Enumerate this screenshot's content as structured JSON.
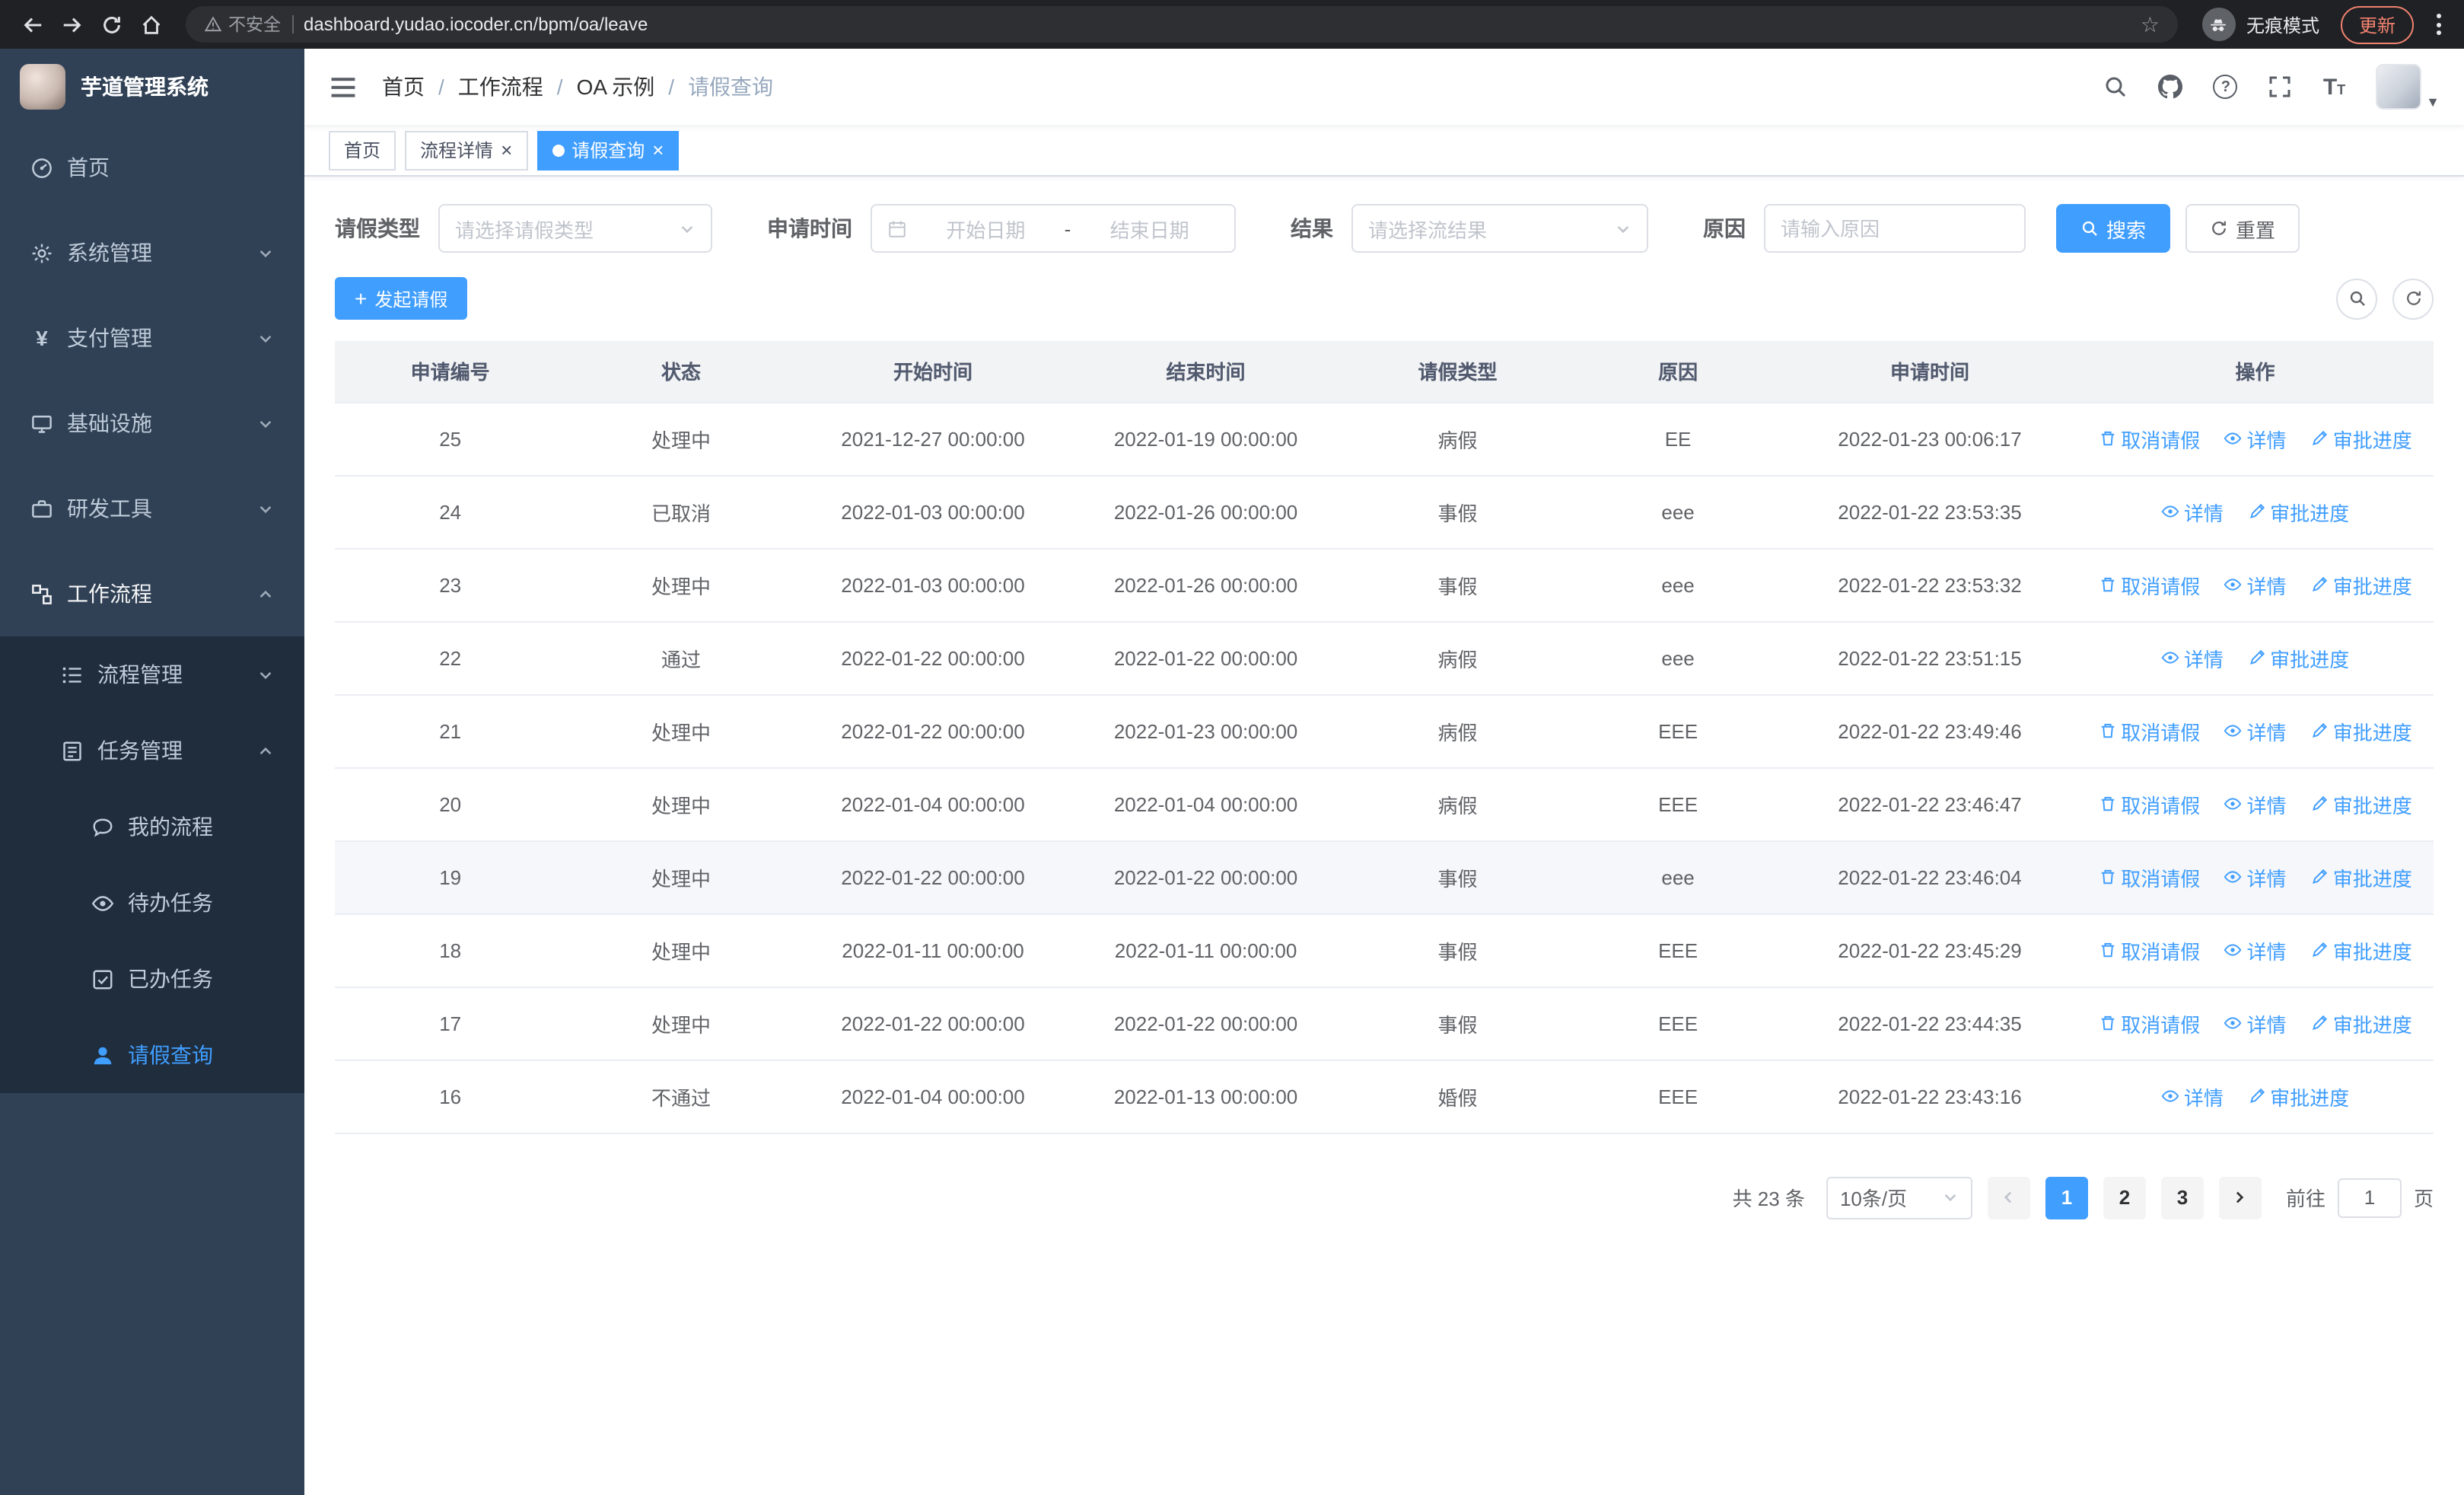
{
  "colors": {
    "primary": "#409eff",
    "sidebar_bg": "#304156",
    "submenu_bg": "#1f2d3d",
    "sidebar_text": "#bfcbd9",
    "chrome_bar_bg": "#202124",
    "update_badge": "#f0826f",
    "table_header_bg": "#f2f3f5"
  },
  "icons": {
    "close": "×",
    "star": "☆",
    "caret_down": "▼",
    "plus": "+",
    "yen": "¥",
    "question": "?",
    "font_t": "T"
  },
  "browser": {
    "security_label": "不安全",
    "url": "dashboard.yudao.iocoder.cn/bpm/oa/leave",
    "incognito_label": "无痕模式",
    "update_button": "更新"
  },
  "sidebar": {
    "logo_title": "芋道管理系统",
    "items": [
      {
        "label": "首页"
      },
      {
        "label": "系统管理"
      },
      {
        "label": "支付管理"
      },
      {
        "label": "基础设施"
      },
      {
        "label": "研发工具"
      },
      {
        "label": "工作流程"
      }
    ],
    "submenu": [
      {
        "label": "流程管理"
      },
      {
        "label": "任务管理"
      }
    ],
    "task_children": [
      {
        "label": "我的流程"
      },
      {
        "label": "待办任务"
      },
      {
        "label": "已办任务"
      },
      {
        "label": "请假查询"
      }
    ]
  },
  "header": {
    "breadcrumb": [
      {
        "label": "首页"
      },
      {
        "label": "工作流程"
      },
      {
        "label": "OA 示例"
      },
      {
        "label": "请假查询"
      }
    ]
  },
  "tabs": [
    {
      "label": "首页"
    },
    {
      "label": "流程详情"
    },
    {
      "label": "请假查询"
    }
  ],
  "filters": {
    "leave_type_label": "请假类型",
    "leave_type_placeholder": "请选择请假类型",
    "apply_time_label": "申请时间",
    "start_date_placeholder": "开始日期",
    "range_separator": "-",
    "end_date_placeholder": "结束日期",
    "result_label": "结果",
    "result_placeholder": "请选择流结果",
    "reason_label": "原因",
    "reason_placeholder": "请输入原因",
    "search_button": "搜索",
    "reset_button": "重置"
  },
  "toolbar": {
    "create_button": "发起请假"
  },
  "table": {
    "columns": [
      "申请编号",
      "状态",
      "开始时间",
      "结束时间",
      "请假类型",
      "原因",
      "申请时间",
      "操作"
    ],
    "actions": {
      "cancel": "取消请假",
      "detail": "详情",
      "progress": "审批进度"
    },
    "rows": [
      {
        "id": "25",
        "status": "处理中",
        "start": "2021-12-27 00:00:00",
        "end": "2022-01-19 00:00:00",
        "type": "病假",
        "reason": "EE",
        "applied": "2022-01-23 00:06:17",
        "can_cancel": true,
        "highlighted": false
      },
      {
        "id": "24",
        "status": "已取消",
        "start": "2022-01-03 00:00:00",
        "end": "2022-01-26 00:00:00",
        "type": "事假",
        "reason": "eee",
        "applied": "2022-01-22 23:53:35",
        "can_cancel": false,
        "highlighted": false
      },
      {
        "id": "23",
        "status": "处理中",
        "start": "2022-01-03 00:00:00",
        "end": "2022-01-26 00:00:00",
        "type": "事假",
        "reason": "eee",
        "applied": "2022-01-22 23:53:32",
        "can_cancel": true,
        "highlighted": false
      },
      {
        "id": "22",
        "status": "通过",
        "start": "2022-01-22 00:00:00",
        "end": "2022-01-22 00:00:00",
        "type": "病假",
        "reason": "eee",
        "applied": "2022-01-22 23:51:15",
        "can_cancel": false,
        "highlighted": false
      },
      {
        "id": "21",
        "status": "处理中",
        "start": "2022-01-22 00:00:00",
        "end": "2022-01-23 00:00:00",
        "type": "病假",
        "reason": "EEE",
        "applied": "2022-01-22 23:49:46",
        "can_cancel": true,
        "highlighted": false
      },
      {
        "id": "20",
        "status": "处理中",
        "start": "2022-01-04 00:00:00",
        "end": "2022-01-04 00:00:00",
        "type": "病假",
        "reason": "EEE",
        "applied": "2022-01-22 23:46:47",
        "can_cancel": true,
        "highlighted": false
      },
      {
        "id": "19",
        "status": "处理中",
        "start": "2022-01-22 00:00:00",
        "end": "2022-01-22 00:00:00",
        "type": "事假",
        "reason": "eee",
        "applied": "2022-01-22 23:46:04",
        "can_cancel": true,
        "highlighted": true
      },
      {
        "id": "18",
        "status": "处理中",
        "start": "2022-01-11 00:00:00",
        "end": "2022-01-11 00:00:00",
        "type": "事假",
        "reason": "EEE",
        "applied": "2022-01-22 23:45:29",
        "can_cancel": true,
        "highlighted": false
      },
      {
        "id": "17",
        "status": "处理中",
        "start": "2022-01-22 00:00:00",
        "end": "2022-01-22 00:00:00",
        "type": "事假",
        "reason": "EEE",
        "applied": "2022-01-22 23:44:35",
        "can_cancel": true,
        "highlighted": false
      },
      {
        "id": "16",
        "status": "不通过",
        "start": "2022-01-04 00:00:00",
        "end": "2022-01-13 00:00:00",
        "type": "婚假",
        "reason": "EEE",
        "applied": "2022-01-22 23:43:16",
        "can_cancel": false,
        "highlighted": false
      }
    ]
  },
  "pagination": {
    "total_text": "共 23 条",
    "page_size": "10条/页",
    "pages": [
      "1",
      "2",
      "3"
    ],
    "active_page": "1",
    "goto_label": "前往",
    "goto_value": "1",
    "goto_suffix": "页"
  }
}
